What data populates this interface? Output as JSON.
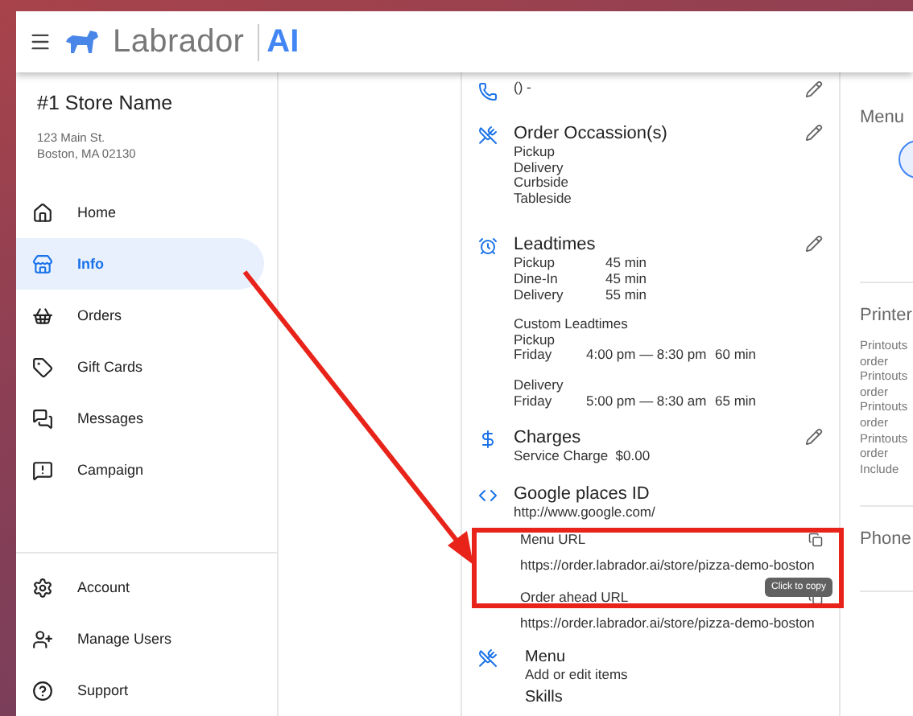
{
  "header": {
    "brand": "Labrador",
    "brand_suffix": "AI"
  },
  "store": {
    "name": "#1 Store Name",
    "address": [
      "123 Main St.",
      "Boston, MA 02130"
    ]
  },
  "nav": [
    {
      "label": "Home",
      "selected": false
    },
    {
      "label": "Info",
      "selected": true
    },
    {
      "label": "Orders",
      "selected": false
    },
    {
      "label": "Gift Cards",
      "selected": false
    },
    {
      "label": "Messages",
      "selected": false
    },
    {
      "label": "Campaign",
      "selected": false
    }
  ],
  "nav_bottom": [
    {
      "label": "Account",
      "selected": false
    },
    {
      "label": "Manage Users",
      "selected": false
    },
    {
      "label": "Support",
      "selected": false
    }
  ],
  "sections": [
    {
      "kind": "list",
      "lines": [
        "() -"
      ],
      "editable": true
    },
    {
      "kind": "list",
      "title": "Order Occassion(s)",
      "lines": [
        "Pickup",
        "Delivery",
        "Curbside",
        "Tableside"
      ],
      "editable": true
    },
    {
      "kind": "leadtimes",
      "title": "Leadtimes",
      "editable": true,
      "rows": [
        [
          "Pickup",
          "45 min"
        ],
        [
          "Dine-In",
          "45 min"
        ],
        [
          "Delivery",
          "55 min"
        ]
      ],
      "custom_title": "Custom Leadtimes",
      "custom_groups": [
        {
          "name": "Pickup",
          "rows": [
            [
              "Friday",
              "4:00 pm — 8:30 pm",
              "60 min"
            ]
          ]
        },
        {
          "name": "Delivery",
          "rows": [
            [
              "Friday",
              "5:00 pm — 8:30 am",
              "65 min"
            ]
          ]
        }
      ]
    },
    {
      "kind": "list",
      "title": "Charges",
      "lines": [
        "Service Charge  $0.00"
      ],
      "editable": true
    },
    {
      "kind": "list",
      "title": "Google places ID",
      "lines": [
        "http://www.google.com/"
      ],
      "editable": false
    }
  ],
  "urls": [
    {
      "label": "Menu URL",
      "url": "https://order.labrador.ai/store/pizza-demo-boston"
    },
    {
      "label": "Order ahead URL",
      "url": "https://order.labrador.ai/store/pizza-demo-boston"
    }
  ],
  "tooltip": "Click to copy",
  "links": [
    {
      "title": "Menu",
      "subtitle": "Add or edit items"
    },
    {
      "title": "Skills"
    }
  ],
  "right_panels": [
    {
      "kind": "toggle",
      "title": "Menu"
    },
    {
      "kind": "lines",
      "title": "Printer",
      "lines": [
        "Printouts",
        "order",
        "Printouts",
        "order",
        "Printouts",
        "order",
        "Printouts",
        "order",
        "Include"
      ]
    },
    {
      "kind": "lines",
      "title": "Phone"
    }
  ],
  "annotation": {
    "arrow": true,
    "highlight": true
  }
}
